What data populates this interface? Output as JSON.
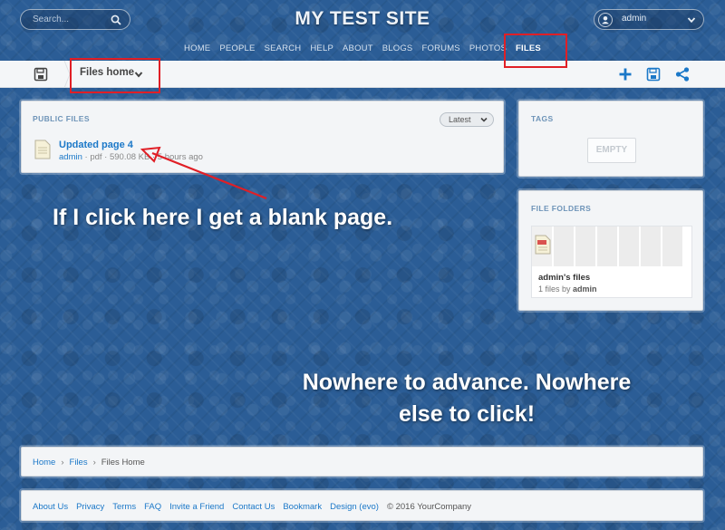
{
  "header": {
    "search_placeholder": "Search...",
    "site_title": "MY TEST SITE",
    "user_name": "admin"
  },
  "nav": {
    "items": [
      "HOME",
      "PEOPLE",
      "SEARCH",
      "HELP",
      "ABOUT",
      "BLOGS",
      "FORUMS",
      "PHOTOS",
      "FILES"
    ],
    "active": "FILES"
  },
  "toolbar": {
    "files_home_label": "Files home"
  },
  "public_files": {
    "title": "PUBLIC FILES",
    "sort_label": "Latest",
    "file": {
      "name": "Updated page 4",
      "owner": "admin",
      "meta": " · pdf · 590.08 KB · 5 hours ago"
    }
  },
  "tags": {
    "title": "TAGS",
    "empty_label": "EMPTY"
  },
  "file_folders": {
    "title": "FILE FOLDERS",
    "folder_name": "admin's files",
    "count_text": "1 files by ",
    "count_owner": "admin"
  },
  "annotations": {
    "blank_page": "If I click here I get a blank page.",
    "nowhere_line1": "Nowhere to advance. Nowhere",
    "nowhere_line2": "else to click!",
    "color": "#e01f26"
  },
  "breadcrumb": {
    "home": "Home",
    "files": "Files",
    "current": "Files Home",
    "sep": "›"
  },
  "footer": {
    "links": [
      "About Us",
      "Privacy",
      "Terms",
      "FAQ",
      "Invite a Friend",
      "Contact Us",
      "Bookmark",
      "Design (evo)"
    ],
    "copyright": "© 2016 YourCompany"
  },
  "colors": {
    "accent": "#1b78c8",
    "background": "#2b5d96"
  }
}
